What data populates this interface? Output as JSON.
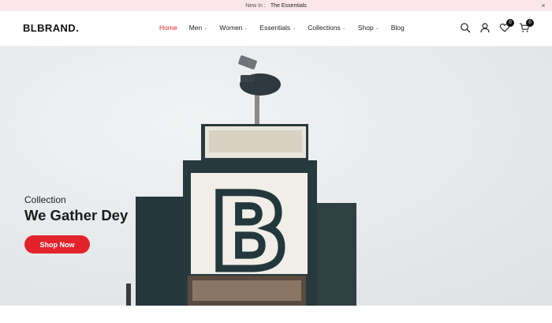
{
  "announcement": {
    "label": "New In :",
    "link_text": "The Essentials",
    "close_glyph": "×"
  },
  "header": {
    "logo": "BLBRAND.",
    "nav": [
      {
        "label": "Home",
        "active": true,
        "has_dropdown": false
      },
      {
        "label": "Men",
        "active": false,
        "has_dropdown": true
      },
      {
        "label": "Women",
        "active": false,
        "has_dropdown": true
      },
      {
        "label": "Essentials",
        "active": false,
        "has_dropdown": true
      },
      {
        "label": "Collections",
        "active": false,
        "has_dropdown": true
      },
      {
        "label": "Shop",
        "active": false,
        "has_dropdown": true
      },
      {
        "label": "Blog",
        "active": false,
        "has_dropdown": false
      }
    ],
    "icons": [
      "search-icon",
      "user-icon",
      "wishlist-icon",
      "cart-icon"
    ],
    "wishlist_count": "0",
    "cart_count": "0"
  },
  "hero": {
    "subtitle": "Collection",
    "title": "We Gather Dey",
    "button_label": "Shop Now",
    "sign_letter": "B"
  },
  "colors": {
    "accent": "#e3232c",
    "announcement_bg": "#fbe7ea",
    "text_dark": "#1c1c1c"
  }
}
